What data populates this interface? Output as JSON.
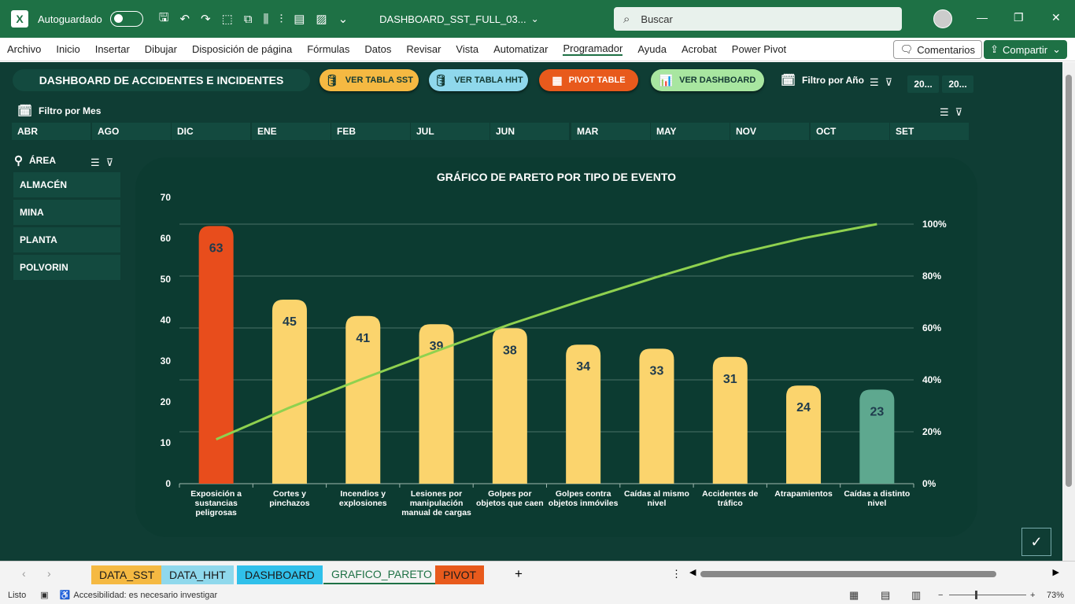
{
  "titlebar": {
    "autosave_label": "Autoguardado",
    "doc_title": "DASHBOARD_SST_FULL_03...",
    "search_placeholder": "Buscar"
  },
  "ribbon": {
    "tabs": [
      "Archivo",
      "Inicio",
      "Insertar",
      "Dibujar",
      "Disposición de página",
      "Fórmulas",
      "Datos",
      "Revisar",
      "Vista",
      "Automatizar",
      "Programador",
      "Ayuda",
      "Acrobat",
      "Power Pivot"
    ],
    "comments_label": "Comentarios",
    "share_label": "Compartir"
  },
  "dashboard": {
    "title": "DASHBOARD DE ACCIDENTES E INCIDENTES",
    "buttons": [
      {
        "label": "VER TABLA SST",
        "bg": "#f5b942",
        "fg": "#143a33"
      },
      {
        "label": "VER TABLA HHT",
        "bg": "#8fd8ec",
        "fg": "#143a33"
      },
      {
        "label": "PIVOT TABLE",
        "bg": "#e85a1c",
        "fg": "#ffffff"
      },
      {
        "label": "VER DASHBOARD",
        "bg": "#a8e6a0",
        "fg": "#143a33"
      }
    ],
    "year_filter_label": "Filtro por Año",
    "years": [
      "20...",
      "20..."
    ],
    "month_filter_label": "Filtro por Mes",
    "months": [
      "ABR",
      "AGO",
      "DIC",
      "ENE",
      "FEB",
      "JUL",
      "JUN",
      "MAR",
      "MAY",
      "NOV",
      "OCT",
      "SET"
    ],
    "area_label": "ÁREA",
    "areas": [
      "ALMACÉN",
      "MINA",
      "PLANTA",
      "POLVORIN"
    ]
  },
  "chart_data": {
    "type": "bar",
    "title": "GRÁFICO DE PARETO POR TIPO DE EVENTO",
    "categories": [
      "Exposición a sustancias peligrosas",
      "Cortes y pinchazos",
      "Incendios y explosiones",
      "Lesiones por manipulación manual de cargas",
      "Golpes por objetos que caen",
      "Golpes contra objetos inmóviles",
      "Caídas al mismo nivel",
      "Accidentes de tráfico",
      "Atrapamientos",
      "Caídas a distinto nivel"
    ],
    "category_lines": [
      [
        "Exposición a",
        "sustancias",
        "peligrosas"
      ],
      [
        "Cortes y",
        "pinchazos"
      ],
      [
        "Incendios y",
        "explosiones"
      ],
      [
        "Lesiones por",
        "manipulación",
        "manual de cargas"
      ],
      [
        "Golpes por",
        "objetos que caen"
      ],
      [
        "Golpes contra",
        "objetos inmóviles"
      ],
      [
        "Caídas al mismo",
        "nivel"
      ],
      [
        "Accidentes de",
        "tráfico"
      ],
      [
        "Atrapamientos"
      ],
      [
        "Caídas a distinto",
        "nivel"
      ]
    ],
    "values": [
      63,
      45,
      41,
      39,
      38,
      34,
      33,
      31,
      24,
      23
    ],
    "bar_colors": [
      "#e84d1c",
      "#fbd46d",
      "#fbd46d",
      "#fbd46d",
      "#fbd46d",
      "#fbd46d",
      "#fbd46d",
      "#fbd46d",
      "#fbd46d",
      "#5ea88f"
    ],
    "cumulative_pct": [
      17.1,
      29.3,
      40.5,
      51.1,
      61.4,
      70.7,
      79.6,
      88.0,
      94.6,
      100.0
    ],
    "ylim": [
      0,
      70
    ],
    "y_ticks": [
      "0",
      "10",
      "20",
      "30",
      "40",
      "50",
      "60",
      "70"
    ],
    "y2_ticks": [
      "0%",
      "20%",
      "40%",
      "60%",
      "80%",
      "100%"
    ],
    "line_color": "#8fd14f",
    "grid": true
  },
  "sheets": {
    "tabs": [
      {
        "label": "DATA_SST",
        "bg": "#f5b942",
        "active": false
      },
      {
        "label": "DATA_HHT",
        "bg": "#8fd8ec",
        "active": false
      },
      {
        "label": "DASHBOARD",
        "bg": "#30c0ea",
        "active": false
      },
      {
        "label": "GRAFICO_PARETO",
        "bg": "#ffffff",
        "active": true
      },
      {
        "label": "PIVOT",
        "bg": "#e85a1c",
        "active": false
      }
    ]
  },
  "status": {
    "ready": "Listo",
    "accessibility": "Accesibilidad: es necesario investigar",
    "zoom": "73%"
  }
}
